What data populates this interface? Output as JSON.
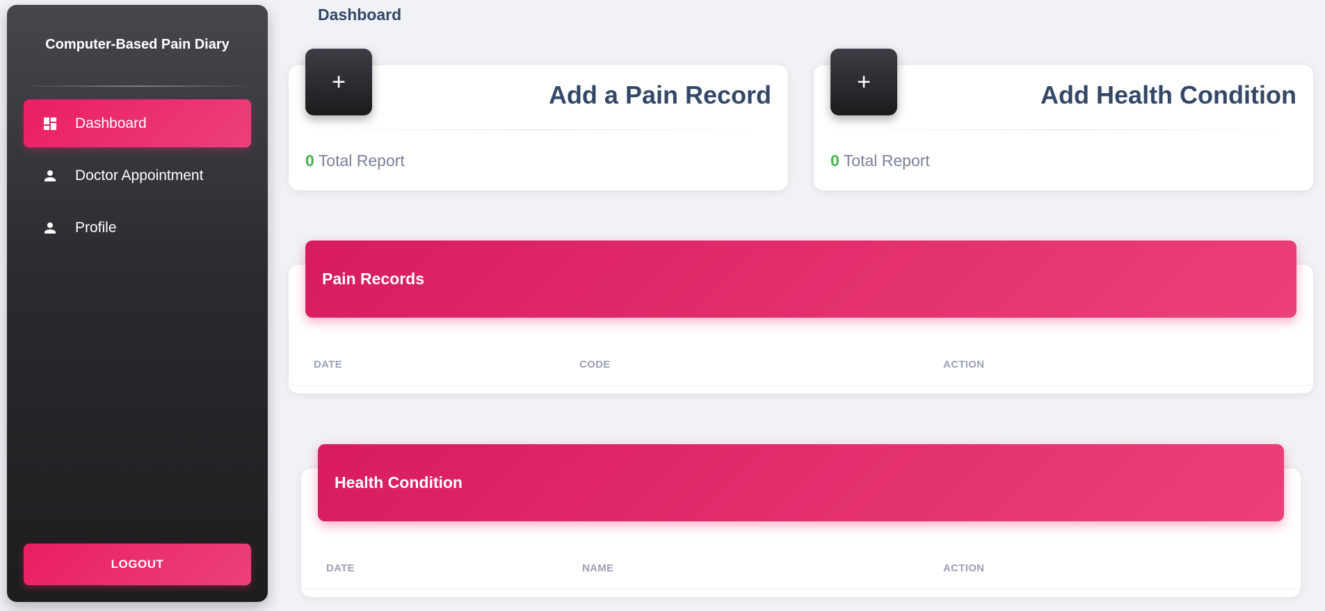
{
  "sidebar": {
    "brand": "Computer-Based Pain Diary",
    "items": [
      {
        "label": "Dashboard",
        "icon": "dashboard-icon",
        "active": true
      },
      {
        "label": "Doctor Appointment",
        "icon": "person-icon",
        "active": false
      },
      {
        "label": "Profile",
        "icon": "person-icon",
        "active": false
      }
    ],
    "logout_label": "LOGOUT"
  },
  "main": {
    "page_title": "Dashboard",
    "cards": [
      {
        "plus": "+",
        "title": "Add a Pain Record",
        "count": "0",
        "footer": "Total Report"
      },
      {
        "plus": "+",
        "title": "Add Health Condition",
        "count": "0",
        "footer": "Total Report"
      }
    ],
    "pain_records": {
      "title": "Pain Records",
      "columns": [
        "DATE",
        "CODE",
        "ACTION"
      ]
    },
    "health_condition": {
      "title": "Health Condition",
      "columns": [
        "DATE",
        "NAME",
        "ACTION"
      ]
    }
  },
  "colors": {
    "accent": "#e91e63",
    "dark": "#1d1d1f",
    "heading": "#344767",
    "success": "#4caf50",
    "muted": "#7b809a"
  }
}
